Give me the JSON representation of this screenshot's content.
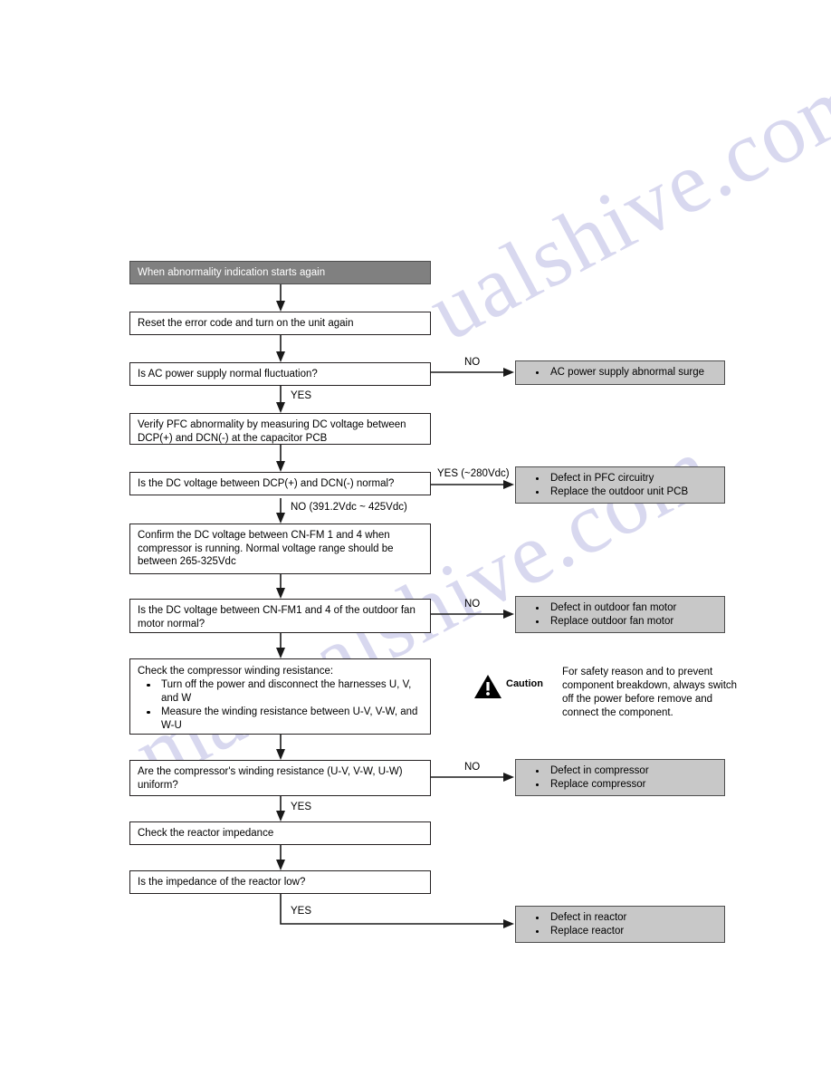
{
  "page": {
    "watermark": [
      "ualshive.com",
      "manualshive.com"
    ]
  },
  "flowchart": {
    "nodes": [
      {
        "id": "header",
        "kind": "header",
        "lines": [
          "When abnormality indication starts again"
        ]
      },
      {
        "id": "reset",
        "kind": "process",
        "lines": [
          "Reset the error code and turn on the unit again"
        ]
      },
      {
        "id": "ac-check",
        "kind": "decision",
        "lines": [
          "Is AC power supply normal fluctuation?"
        ]
      },
      {
        "id": "verify-pfc",
        "kind": "process",
        "lines": [
          "Verify PFC abnormality by measuring DC voltage between",
          "DCP(+) and DCN(-) at the capacitor PCB"
        ]
      },
      {
        "id": "dc-check",
        "kind": "decision",
        "lines": [
          "Is the DC voltage between DCP(+) and DCN(-) normal?"
        ]
      },
      {
        "id": "confirm-fm",
        "kind": "process",
        "lines": [
          "Confirm the DC voltage between CN-FM 1 and 4 when",
          "compressor is running. Normal voltage range should be",
          "between 265-325Vdc"
        ]
      },
      {
        "id": "fm-check",
        "kind": "decision",
        "lines": [
          "Is the DC voltage between CN-FM1 and 4 of the outdoor fan",
          "motor normal?"
        ]
      },
      {
        "id": "check-winding",
        "kind": "process-bullets",
        "title": "Check the compressor winding resistance:",
        "bullets": [
          "Turn off the power and disconnect the harnesses U, V, and W",
          "Measure the winding resistance between U-V, V-W, and W-U"
        ]
      },
      {
        "id": "winding-check",
        "kind": "decision",
        "lines": [
          "Are the compressor's winding resistance (U-V, V-W, U-W)",
          "uniform?"
        ]
      },
      {
        "id": "check-reactor",
        "kind": "process",
        "lines": [
          "Check the reactor impedance"
        ]
      },
      {
        "id": "reactor-check",
        "kind": "decision",
        "lines": [
          "Is the impedance of the reactor low?"
        ]
      }
    ],
    "results": [
      {
        "id": "result-ac",
        "bullets": [
          "AC power supply abnormal surge"
        ]
      },
      {
        "id": "result-pfc",
        "bullets": [
          "Defect in PFC circuitry",
          "Replace the outdoor unit PCB"
        ]
      },
      {
        "id": "result-fan",
        "bullets": [
          "Defect in outdoor fan motor",
          "Replace outdoor fan motor"
        ]
      },
      {
        "id": "result-compressor",
        "bullets": [
          "Defect in compressor",
          "Replace compressor"
        ]
      },
      {
        "id": "result-reactor",
        "bullets": [
          "Defect in reactor",
          "Replace reactor"
        ]
      }
    ],
    "edge_labels": {
      "ac_no": "NO",
      "ac_yes": "YES",
      "dc_yes": "YES (~280Vdc)",
      "dc_no": "NO (391.2Vdc ~ 425Vdc)",
      "fm_no": "NO",
      "winding_no": "NO",
      "winding_yes": "YES",
      "reactor_yes": "YES"
    }
  },
  "caution": {
    "label": "Caution",
    "lines": [
      "For safety reason and to prevent",
      "component breakdown, always switch",
      "off the power before remove and",
      "connect the component."
    ]
  },
  "colors": {
    "header_fill": "#808080",
    "result_fill": "#c8c8c8",
    "border": "#231f20",
    "watermark": "#b9b9e2"
  }
}
